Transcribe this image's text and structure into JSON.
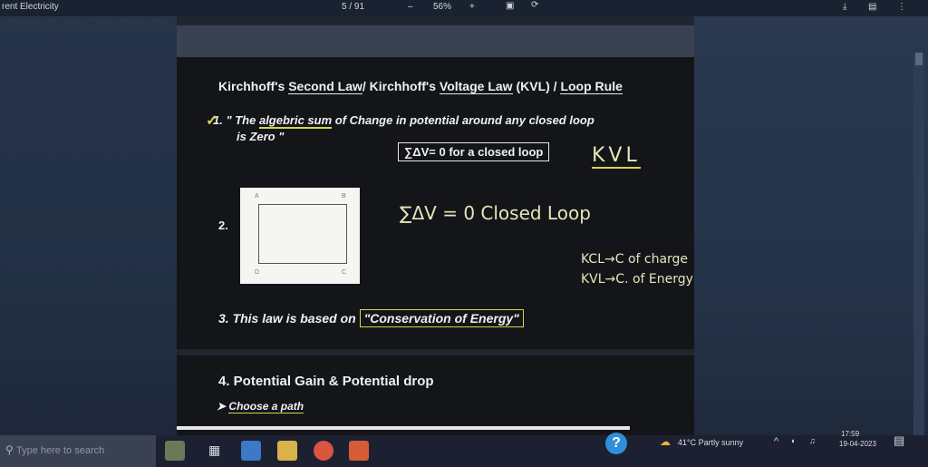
{
  "topbar": {
    "left_title": "rent Electricity",
    "page": "5 / 91",
    "minus": "–",
    "zoom": "56%",
    "plus": "+"
  },
  "slide": {
    "title_a": "Kirchhoff's ",
    "title_b": "Second Law",
    "title_c": "/ Kirchhoff's ",
    "title_d": "Voltage Law",
    "title_e": " (KVL) / ",
    "title_f": "Loop Rule",
    "item1_num": "1.",
    "item1_pre": "\" The ",
    "item1_ul": "algebric sum",
    "item1_post": " of Change in potential around any closed loop",
    "item1_line2": "is Zero \"",
    "kvl_box": "∑ΔV= 0  for a closed loop",
    "kvl_hand": "KVL",
    "item2_num": "2.",
    "loop_labels": [
      "A",
      "B",
      "C",
      "D"
    ],
    "eq2": "∑ΔV = 0   Closed Loop",
    "kcl_line": "KCL→C of charge",
    "kvl_line": "KVL→C. of Energy",
    "item3_pre": "3.  This law is based on ",
    "item3_box": "\"Conservation of Energy\""
  },
  "slide2": {
    "item4": "4.  Potential Gain & Potential drop",
    "arrow": "➤",
    "choose": "Choose a path"
  },
  "taskbar": {
    "search_placeholder": "Type here to search",
    "weather": "41°C  Partly sunny",
    "time": "17:59",
    "date": "19-04-2023",
    "help_label": "?"
  },
  "icons": [
    "search-icon",
    "task-view-icon",
    "file-explorer-icon",
    "folder-icon",
    "chrome-icon",
    "app-icon",
    "help-icon",
    "weather-icon",
    "chevron-up-icon",
    "network-icon",
    "volume-icon",
    "notification-icon",
    "download-icon",
    "print-icon",
    "more-icon",
    "fit-page-icon",
    "rotate-icon"
  ]
}
